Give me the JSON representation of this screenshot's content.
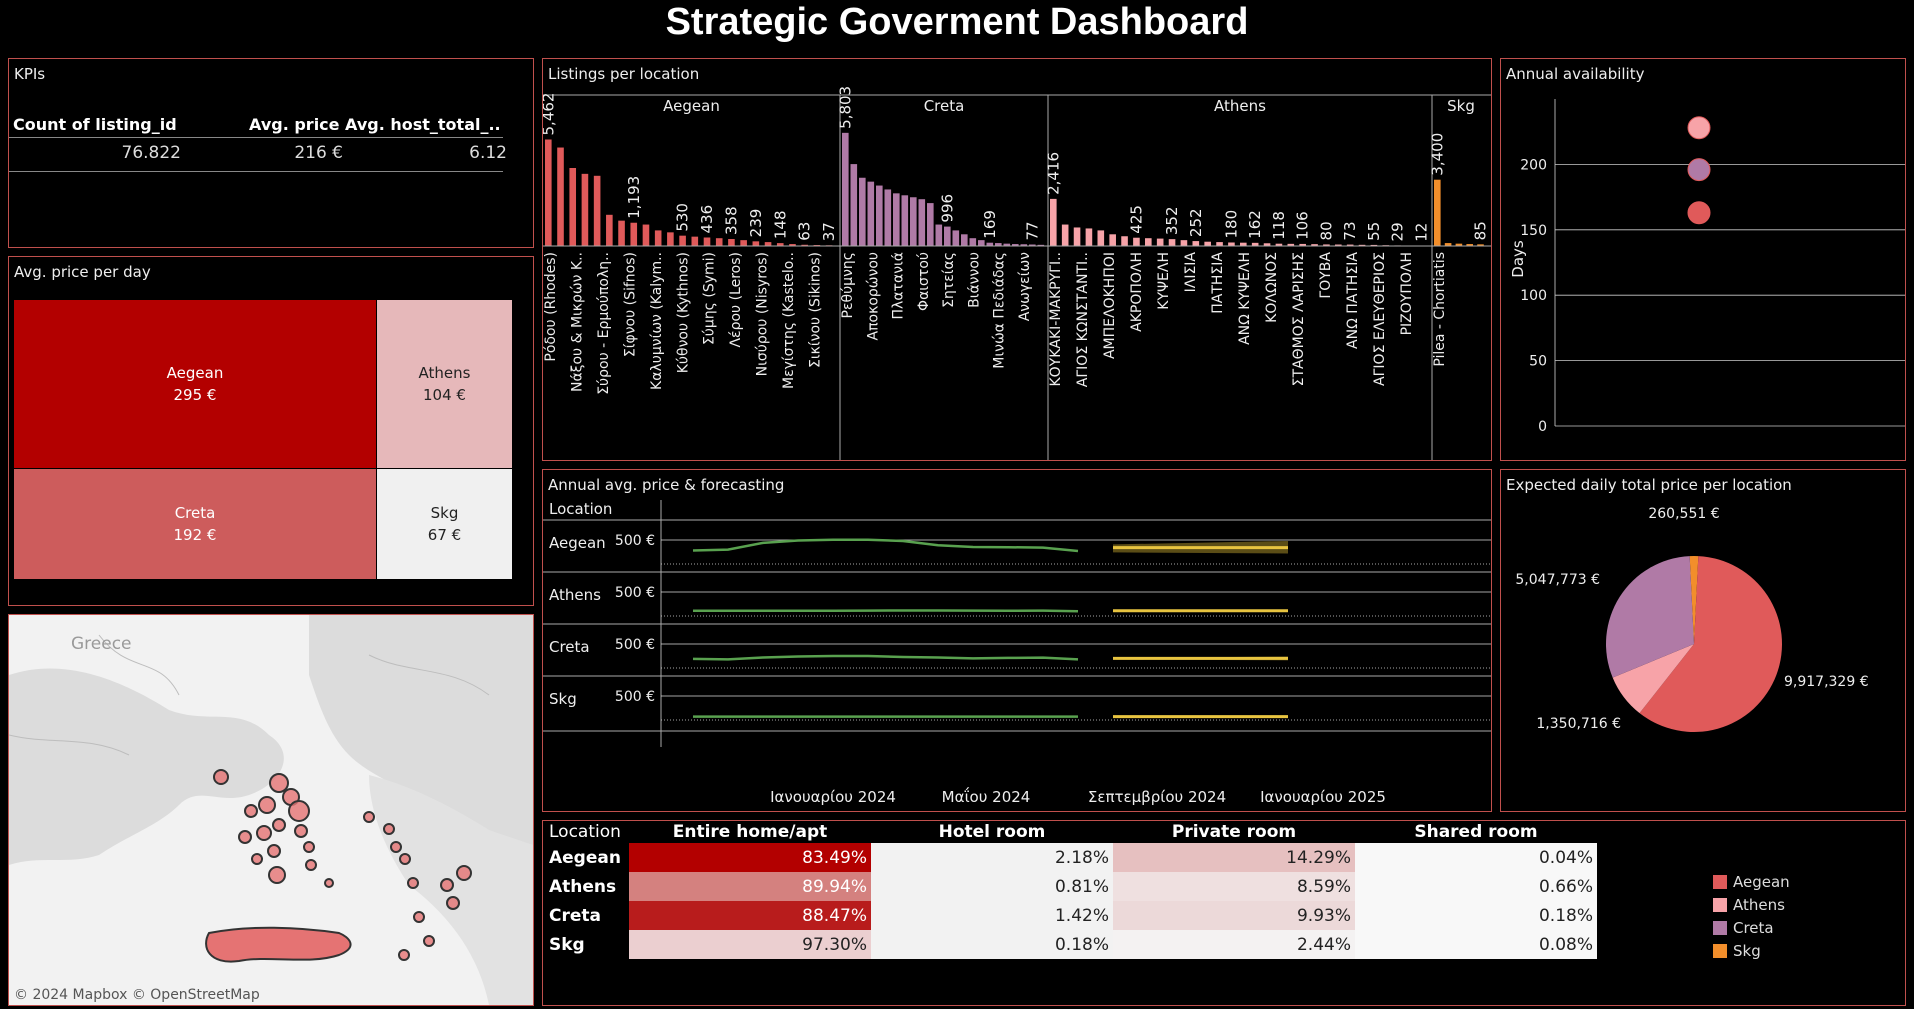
{
  "header": {
    "title": "Strategic Goverment Dashboard"
  },
  "colors": {
    "aegean": "#e05a5a",
    "athens": "#f7a3a8",
    "creta": "#b07aa6",
    "skg": "#f28e2b",
    "border": "#c0504d",
    "forecast_line": "#e8c440",
    "trend_line": "#59a14f"
  },
  "kpis": {
    "title": "KPIs",
    "headers": [
      "Count of listing_id",
      "Avg. price",
      "Avg. host_total_.."
    ],
    "values": [
      "76.822",
      "216 €",
      "6.12"
    ]
  },
  "avg_price_per_day": {
    "title": "Avg. price per day",
    "cells": [
      {
        "name": "Aegean",
        "value": "295 €",
        "fill": "#b30000",
        "text": "#ffffff"
      },
      {
        "name": "Athens",
        "value": "104 €",
        "fill": "#e6b8ba",
        "text": "#222222"
      },
      {
        "name": "Creta",
        "value": "192 €",
        "fill": "#cd5c5c",
        "text": "#ffffff"
      },
      {
        "name": "Skg",
        "value": "67 €",
        "fill": "#f0f0f0",
        "text": "#222222"
      }
    ]
  },
  "map": {
    "label_country": "Greece",
    "attribution": "© 2024 Mapbox © OpenStreetMap"
  },
  "listings": {
    "title": "Listings per location",
    "groups": [
      {
        "name": "Aegean",
        "color": "#e05a5a",
        "values": [
          5462,
          5050,
          4000,
          3700,
          3600,
          1600,
          1300,
          1193,
          1100,
          800,
          700,
          530,
          480,
          436,
          400,
          358,
          300,
          239,
          200,
          148,
          100,
          63,
          50,
          37
        ],
        "labels": [
          {
            "i": 0,
            "v": "5,462"
          },
          {
            "i": 7,
            "v": "1,193"
          },
          {
            "i": 11,
            "v": "530"
          },
          {
            "i": 13,
            "v": "436"
          },
          {
            "i": 15,
            "v": "358"
          },
          {
            "i": 17,
            "v": "239"
          },
          {
            "i": 19,
            "v": "148"
          },
          {
            "i": 21,
            "v": "63"
          },
          {
            "i": 23,
            "v": "37"
          }
        ],
        "ticks": [
          "Ρόδου (Rhodes)",
          "Νάξου & Μικρών Κ..",
          "Σύρου - Ερμούπολη..",
          "Σίφνου (Sifnos)",
          "Καλυμνίων (Kalym..",
          "Κύθνου (Kythnos)",
          "Σύμης (Symi)",
          "Λέρου (Leros)",
          "Νισύρου (Nisyros)",
          "Μεγίστης (Kastelo..",
          "Σικίνου (Sikinos)"
        ]
      },
      {
        "name": "Creta",
        "color": "#b07aa6",
        "values": [
          5803,
          4200,
          3500,
          3300,
          3100,
          2900,
          2700,
          2600,
          2500,
          2400,
          2200,
          1100,
          996,
          800,
          600,
          400,
          300,
          169,
          150,
          120,
          100,
          90,
          77,
          60
        ],
        "labels": [
          {
            "i": 0,
            "v": "5,803"
          },
          {
            "i": 12,
            "v": "996"
          },
          {
            "i": 17,
            "v": "169"
          },
          {
            "i": 22,
            "v": "77"
          }
        ],
        "ticks": [
          "Ρεθύμνης",
          "Αποκορώνου",
          "Πλατανιά",
          "Φαιστού",
          "Σητείας",
          "Βιάννου",
          "Μινώα Πεδιάδας",
          "Ανωγείων"
        ]
      },
      {
        "name": "Athens",
        "color": "#f7a3a8",
        "values": [
          2416,
          1100,
          950,
          900,
          800,
          600,
          500,
          425,
          400,
          380,
          352,
          300,
          252,
          220,
          200,
          180,
          170,
          162,
          140,
          118,
          110,
          106,
          95,
          80,
          75,
          73,
          60,
          55,
          40,
          29,
          20,
          12
        ],
        "labels": [
          {
            "i": 0,
            "v": "2,416"
          },
          {
            "i": 7,
            "v": "425"
          },
          {
            "i": 10,
            "v": "352"
          },
          {
            "i": 12,
            "v": "252"
          },
          {
            "i": 15,
            "v": "180"
          },
          {
            "i": 17,
            "v": "162"
          },
          {
            "i": 19,
            "v": "118"
          },
          {
            "i": 21,
            "v": "106"
          },
          {
            "i": 23,
            "v": "80"
          },
          {
            "i": 25,
            "v": "73"
          },
          {
            "i": 27,
            "v": "55"
          },
          {
            "i": 29,
            "v": "29"
          },
          {
            "i": 31,
            "v": "12"
          }
        ],
        "ticks": [
          "ΚΟΥΚΑΚΙ-ΜΑΚΡΥΓΙ..",
          "ΑΓΙΟΣ ΚΩΝΣΤΑΝΤΙ..",
          "ΑΜΠΕΛΟΚΗΠΟΙ",
          "ΑΚΡΟΠΟΛΗ",
          "ΚΥΨΕΛΗ",
          "ΙΛΙΣΙΑ",
          "ΠΑΤΗΣΙΑ",
          "ΑΝΩ ΚΥΨΕΛΗ",
          "ΚΟΛΩΝΟΣ",
          "ΣΤΑΘΜΟΣ ΛΑΡΙΣΗΣ",
          "ΓΟΥΒΑ",
          "ΑΝΩ ΠΑΤΗΣΙΑ",
          "ΑΓΙΟΣ ΕΛΕΥΘΕΡΙΟΣ",
          "ΡΙΖΟΥΠΟΛΗ"
        ]
      },
      {
        "name": "Skg",
        "color": "#f28e2b",
        "values": [
          3400,
          150,
          120,
          100,
          85
        ],
        "labels": [
          {
            "i": 0,
            "v": "3,400"
          },
          {
            "i": 4,
            "v": "85"
          }
        ],
        "ticks": [
          "Pilea - Chortiatis"
        ]
      }
    ]
  },
  "annual_availability": {
    "title": "Annual availability",
    "ylabel": "Days",
    "ticks": [
      "0",
      "50",
      "100",
      "150",
      "200"
    ],
    "points": [
      {
        "name": "Athens",
        "value": 228,
        "color": "#f7a3a8"
      },
      {
        "name": "Creta",
        "value": 196,
        "color": "#b07aa6"
      },
      {
        "name": "Aegean",
        "value": 163,
        "color": "#e05a5a"
      }
    ]
  },
  "forecast": {
    "title": "Annual avg. price & forecasting",
    "row_header": "Location",
    "axis_label": "500 €",
    "rows": [
      {
        "name": "Aegean",
        "actual": [
          280,
          300,
          440,
          490,
          505,
          505,
          480,
          390,
          355,
          350,
          340,
          270
        ],
        "forecast": 340,
        "band": [
          220,
          480
        ]
      },
      {
        "name": "Athens",
        "actual": [
          110,
          110,
          110,
          110,
          110,
          112,
          115,
          115,
          112,
          110,
          112,
          100
        ],
        "forecast": 110,
        "band": [
          100,
          120
        ]
      },
      {
        "name": "Creta",
        "actual": [
          190,
          180,
          220,
          240,
          250,
          250,
          230,
          220,
          200,
          210,
          215,
          180
        ],
        "forecast": 200,
        "band": [
          160,
          240
        ]
      },
      {
        "name": "Skg",
        "actual": [
          70,
          70,
          70,
          70,
          70,
          70,
          70,
          70,
          70,
          70,
          70,
          70
        ],
        "forecast": 70,
        "band": [
          65,
          75
        ]
      }
    ],
    "x_ticks": [
      "Ιανουαρίου 2024",
      "Μαΐου 2024",
      "Σεπτεμβρίου 2024",
      "Ιανουαρίου 2025"
    ]
  },
  "expected_daily": {
    "title": "Expected daily total price per location",
    "slices": [
      {
        "name": "Aegean",
        "value": 9917329,
        "label": "9,917,329 €",
        "color": "#e05a5a"
      },
      {
        "name": "Athens",
        "value": 1350716,
        "label": "1,350,716 €",
        "color": "#f7a3a8"
      },
      {
        "name": "Creta",
        "value": 5047773,
        "label": "5,047,773 €",
        "color": "#b07aa6"
      },
      {
        "name": "Skg",
        "value": 260551,
        "label": "260,551 €",
        "color": "#f28e2b"
      }
    ]
  },
  "room_table": {
    "headers": [
      "Location",
      "Entire home/apt",
      "Hotel room",
      "Private room",
      "Shared room"
    ],
    "rows": [
      {
        "name": "Aegean",
        "cells": [
          "83.49%",
          "2.18%",
          "14.29%",
          "0.04%"
        ],
        "fills": [
          "#b30000",
          "#f2f2f2",
          "#e6c0c0",
          "#f8f8f8"
        ]
      },
      {
        "name": "Athens",
        "cells": [
          "89.94%",
          "0.81%",
          "8.59%",
          "0.66%"
        ],
        "fills": [
          "#d4817f",
          "#f2f2f2",
          "#efe0e0",
          "#f8f8f8"
        ]
      },
      {
        "name": "Creta",
        "cells": [
          "88.47%",
          "1.42%",
          "9.93%",
          "0.18%"
        ],
        "fills": [
          "#b81c1c",
          "#f2f2f2",
          "#ecd9d9",
          "#f8f8f8"
        ]
      },
      {
        "name": "Skg",
        "cells": [
          "97.30%",
          "0.18%",
          "2.44%",
          "0.08%"
        ],
        "fills": [
          "#ebcfd0",
          "#f2f2f2",
          "#f4f2f2",
          "#f8f8f8"
        ]
      }
    ]
  },
  "legend": [
    {
      "name": "Aegean",
      "color": "#e05a5a"
    },
    {
      "name": "Athens",
      "color": "#f7a3a8"
    },
    {
      "name": "Creta",
      "color": "#b07aa6"
    },
    {
      "name": "Skg",
      "color": "#f28e2b"
    }
  ]
}
